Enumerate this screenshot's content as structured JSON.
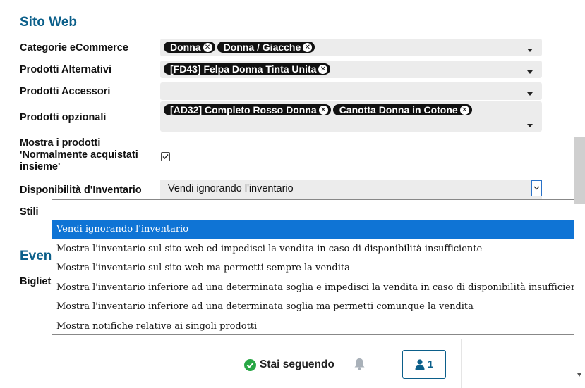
{
  "section_sito_web": "Sito Web",
  "section_eventi": "Eventi",
  "fields": {
    "categorie_label": "Categorie eCommerce",
    "categorie_tags": [
      "Donna",
      "Donna / Giacche"
    ],
    "alternativi_label": "Prodotti Alternativi",
    "alternativi_tags": [
      "[FD43] Felpa Donna Tinta Unita"
    ],
    "accessori_label": "Prodotti Accessori",
    "opzionali_label": "Prodotti opzionali",
    "opzionali_tags": [
      "[AD32] Completo Rosso Donna",
      "Canotta Donna in Cotone"
    ],
    "mostra_label_1": "Mostra i prodotti",
    "mostra_label_2": "'Normalmente acquistati",
    "mostra_label_3": "insieme'",
    "mostra_checked": true,
    "disponibilita_label": "Disponibilità d'Inventario",
    "disponibilita_value": "Vendi ignorando l'inventario",
    "stili_label": "Stili",
    "biglietti_label": "Bigliet"
  },
  "dropdown": {
    "options": [
      "Vendi ignorando l'inventario",
      "Mostra l'inventario sul sito web ed impedisci la vendita in caso di disponibilità insufficiente",
      "Mostra l'inventario sul sito web ma permetti sempre la vendita",
      "Mostra l'inventario inferiore ad una determinata soglia e impedisci la vendita in caso di disponibilità insufficiente",
      "Mostra l'inventario inferiore ad una determinata soglia ma permetti comunque la vendita",
      "Mostra notifiche relative ai singoli prodotti"
    ],
    "selected_index": 0
  },
  "footer": {
    "following_label": "Stai seguendo",
    "followers_count": "1"
  },
  "colors": {
    "accent": "#0b5f8a",
    "selected_option": "#0f74d5",
    "following_green": "#28a745",
    "followers_button_border": "#0b5f8a"
  },
  "icons": {
    "tag_remove": "close-icon",
    "check": "check-circle-icon",
    "bell": "bell-icon",
    "followers": "user-icon",
    "dropdown": "chevron-down-icon"
  }
}
